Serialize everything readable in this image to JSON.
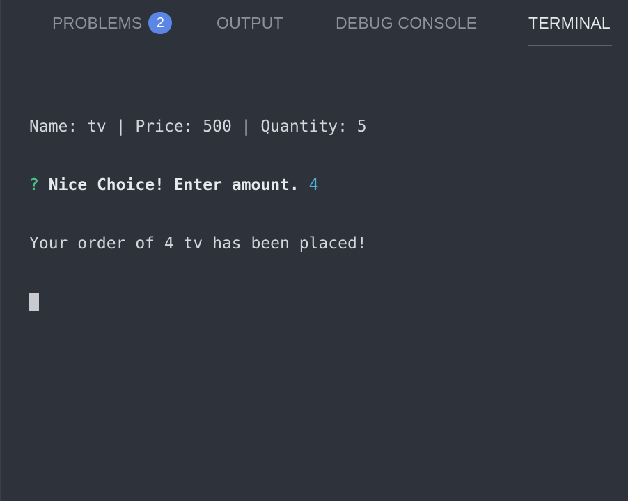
{
  "tabs": {
    "problems": {
      "label": "PROBLEMS",
      "badge": "2"
    },
    "output": {
      "label": "OUTPUT"
    },
    "debug_console": {
      "label": "DEBUG CONSOLE"
    },
    "terminal": {
      "label": "TERMINAL",
      "active": true
    }
  },
  "terminal": {
    "line1": "Name: tv | Price: 500 | Quantity: 5",
    "prompt": {
      "mark": "?",
      "text": "Nice Choice! Enter amount.",
      "answer": "4"
    },
    "line3": "Your order of 4 tv has been placed!"
  },
  "colors": {
    "background": "#2e323b",
    "active_tab": "#e6e8ec",
    "inactive_tab": "#8c919b",
    "badge": "#5c86e6",
    "prompt_mark": "#4bbf86",
    "prompt_answer": "#4fb3d9"
  }
}
